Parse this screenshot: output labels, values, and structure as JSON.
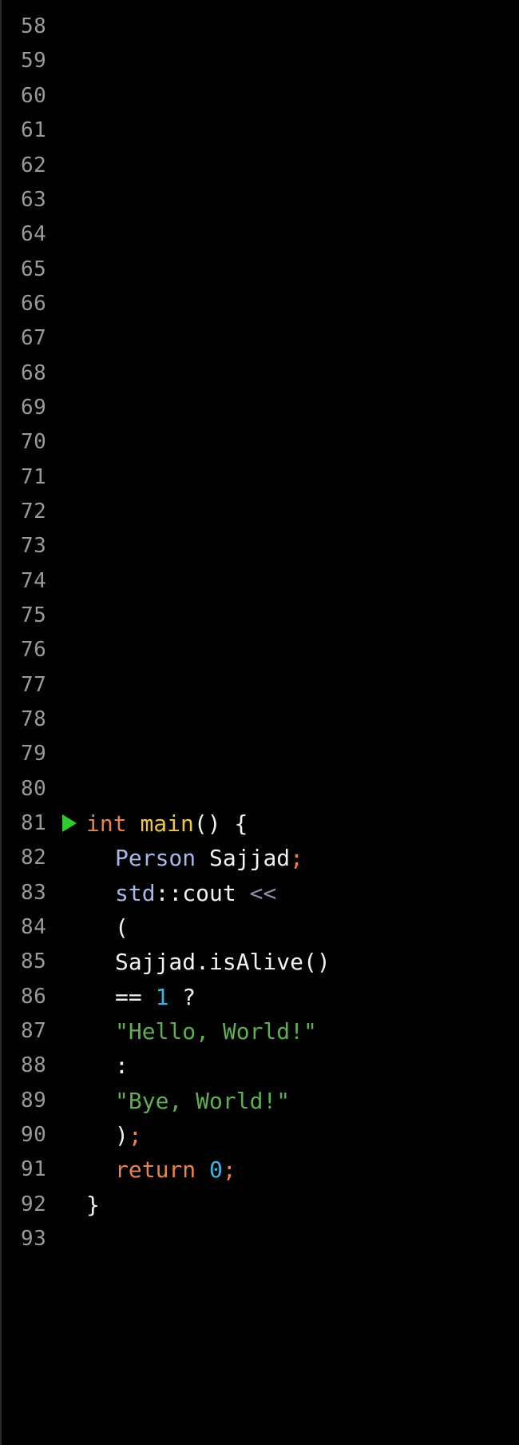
{
  "editor": {
    "gutter": {
      "line_numbers": [
        "58",
        "59",
        "60",
        "61",
        "62",
        "63",
        "64",
        "65",
        "66",
        "67",
        "68",
        "69",
        "70",
        "71",
        "72",
        "73",
        "74",
        "75",
        "76",
        "77",
        "78",
        "79",
        "80",
        "81",
        "82",
        "83",
        "84",
        "85",
        "86",
        "87",
        "88",
        "89",
        "90",
        "91",
        "92",
        "93"
      ]
    },
    "run_icon_line": "81",
    "code": {
      "l81": {
        "type": "int",
        "fn": "main",
        "rest": "() {"
      },
      "l82": {
        "cls": "Person",
        "name": "Sajjad",
        "semi": ";"
      },
      "l83": {
        "ns": "std",
        "sep": "::",
        "ident": "cout",
        "op": "<<"
      },
      "l84": {
        "text": "("
      },
      "l85": {
        "text": "Sajjad.isAlive()"
      },
      "l86": {
        "op": "==",
        "num": "1",
        "q": "?"
      },
      "l87": {
        "str": "\"Hello, World!\""
      },
      "l88": {
        "text": ":"
      },
      "l89": {
        "str": "\"Bye, World!\""
      },
      "l90": {
        "paren": ")",
        "semi": ";"
      },
      "l91": {
        "kw": "return",
        "num": "0",
        "semi": ";"
      },
      "l92": {
        "text": "}"
      }
    },
    "colors": {
      "background": "#000000",
      "line_number": "#9a9a9a",
      "keyword": "#e8834a",
      "function": "#f0c545",
      "class": "#a9b7e8",
      "string": "#5fae52",
      "number": "#38b6e8",
      "run_icon": "#2ecc2e"
    }
  }
}
